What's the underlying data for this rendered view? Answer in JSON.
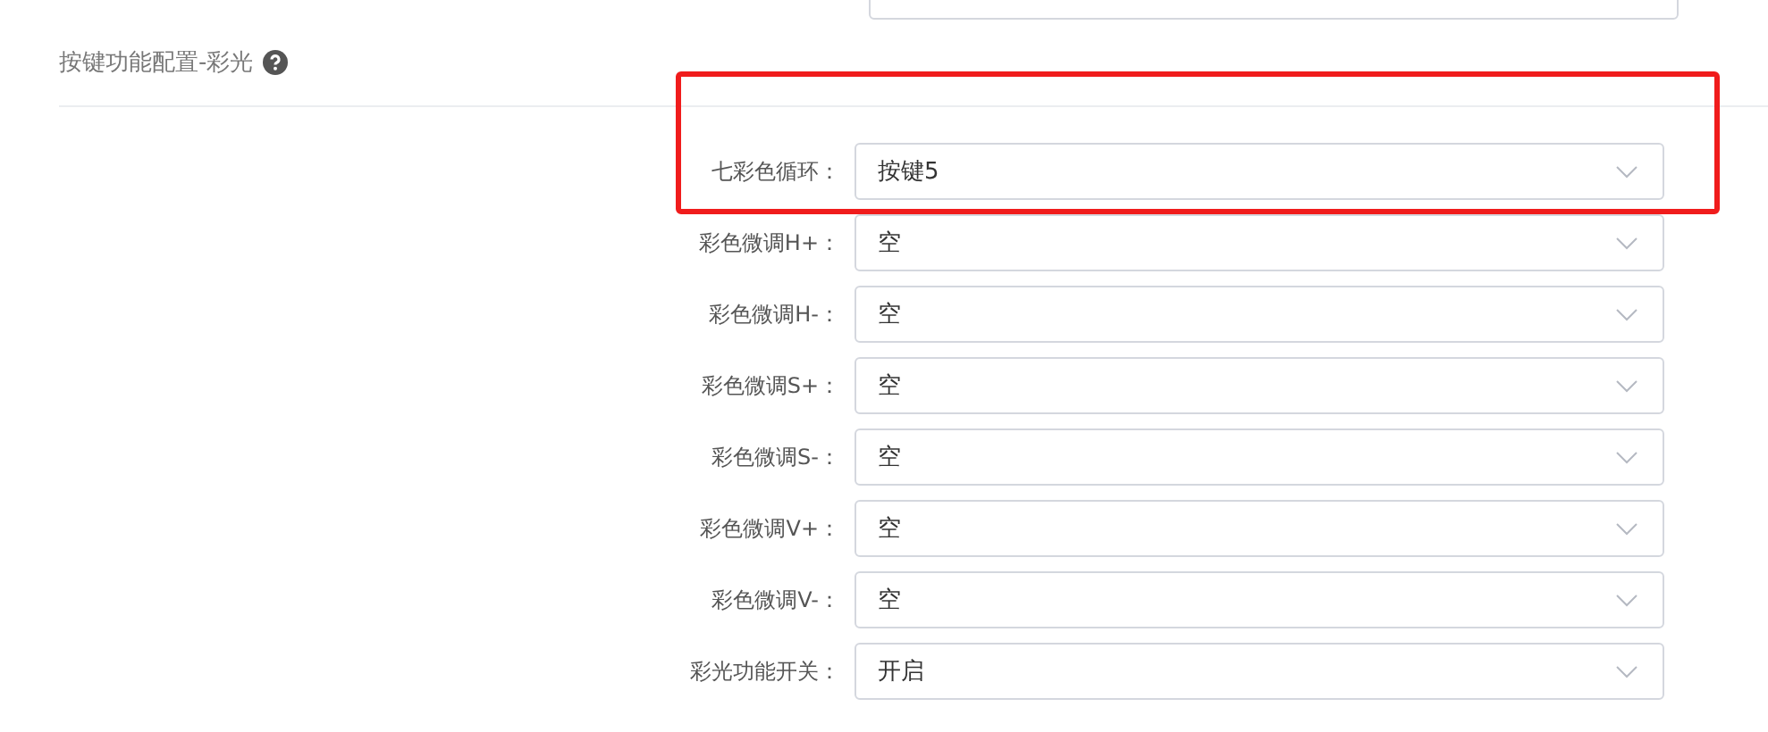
{
  "section": {
    "title": "按键功能配置-彩光"
  },
  "rows": [
    {
      "label": "七彩色循环：",
      "value": "按键5",
      "highlighted": true
    },
    {
      "label": "彩色微调H+：",
      "value": "空",
      "highlighted": false
    },
    {
      "label": "彩色微调H-：",
      "value": "空",
      "highlighted": false
    },
    {
      "label": "彩色微调S+：",
      "value": "空",
      "highlighted": false
    },
    {
      "label": "彩色微调S-：",
      "value": "空",
      "highlighted": false
    },
    {
      "label": "彩色微调V+：",
      "value": "空",
      "highlighted": false
    },
    {
      "label": "彩色微调V-：",
      "value": "空",
      "highlighted": false
    },
    {
      "label": "彩光功能开关：",
      "value": "开启",
      "highlighted": false
    }
  ]
}
